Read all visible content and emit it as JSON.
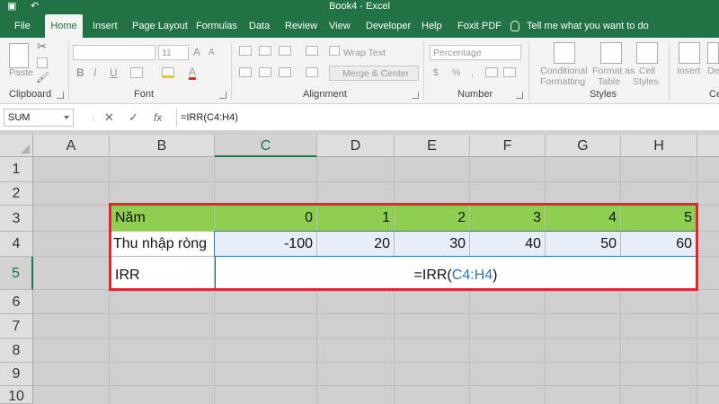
{
  "window": {
    "title": "Book4  -  Excel"
  },
  "tabs": [
    "File",
    "Home",
    "Insert",
    "Page Layout",
    "Formulas",
    "Data",
    "Review",
    "View",
    "Developer",
    "Help",
    "Foxit PDF"
  ],
  "active_tab": "Home",
  "tell_me": "Tell me what you want to do",
  "ribbon": {
    "clipboard": {
      "label": "Clipboard",
      "paste": "Paste"
    },
    "font": {
      "label": "Font",
      "size": "11",
      "bold": "B",
      "italic": "I",
      "underline": "U",
      "grow": "A",
      "shrink": "A"
    },
    "alignment": {
      "label": "Alignment",
      "wrap_text": "Wrap Text",
      "merge_center": "Merge & Center"
    },
    "number": {
      "label": "Number",
      "format": "Percentage",
      "currency": "$",
      "percent": "%",
      "comma": ","
    },
    "styles": {
      "label": "Styles",
      "conditional_1": "Conditional",
      "conditional_2": "Formatting",
      "format_as_1": "Format as",
      "format_as_2": "Table",
      "cell_styles_1": "Cell",
      "cell_styles_2": "Styles"
    },
    "cells": {
      "label": "Ce",
      "insert": "Insert",
      "delete": "De"
    }
  },
  "formula_bar": {
    "name_box": "SUM",
    "cancel": "✕",
    "enter": "✓",
    "fx": "fx",
    "formula": "=IRR(C4:H4)"
  },
  "columns": [
    "A",
    "B",
    "C",
    "D",
    "E",
    "F",
    "G",
    "H"
  ],
  "rows": [
    "1",
    "2",
    "3",
    "4",
    "5",
    "6",
    "7",
    "8",
    "9",
    "10"
  ],
  "cells": {
    "B3": "Năm",
    "C3": "0",
    "D3": "1",
    "E3": "2",
    "F3": "3",
    "G3": "4",
    "H3": "5",
    "B4": "Thu nhập ròng",
    "C4": "-100",
    "D4": "20",
    "E4": "30",
    "F4": "40",
    "G4": "50",
    "H4": "60",
    "B5": "IRR",
    "C5_prefix": "=IRR(",
    "C5_ref": "C4:H4",
    "C5_suffix": ")"
  },
  "colors": {
    "excel_green": "#217346",
    "header_fill": "#8fcf4f",
    "highlight_box": "#e0282e",
    "ref_blue": "#2e75b6"
  }
}
